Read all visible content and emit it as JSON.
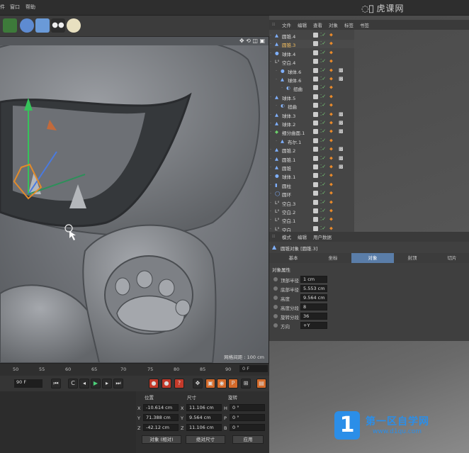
{
  "menubar": {
    "items": [
      "件",
      "窗口",
      "帮助"
    ]
  },
  "watermark_top": "虎课网",
  "viewport": {
    "grid_label": "网格间距 : 100 cm"
  },
  "timeline": {
    "ticks": [
      "50",
      "55",
      "60",
      "65",
      "70",
      "75",
      "80",
      "85",
      "90"
    ],
    "current": "0 F",
    "end_frame": "90 F"
  },
  "coords": {
    "headers": {
      "position": "位置",
      "size": "尺寸",
      "rotation": "旋转"
    },
    "rows": [
      {
        "axis": "X",
        "pos": "-10.614 cm",
        "saxis": "X",
        "size": "11.106 cm",
        "raxis": "H",
        "rot": "0 °"
      },
      {
        "axis": "Y",
        "pos": "71.388 cm",
        "saxis": "Y",
        "size": "9.564 cm",
        "raxis": "P",
        "rot": "0 °"
      },
      {
        "axis": "Z",
        "pos": "-42.12 cm",
        "saxis": "Z",
        "size": "11.106 cm",
        "raxis": "B",
        "rot": "0 °"
      }
    ],
    "mode1": "对象 (相对)",
    "mode2": "绝对尺寸",
    "apply": "应用"
  },
  "object_manager": {
    "menu": [
      "文件",
      "编辑",
      "查看",
      "对象",
      "标签",
      "书签"
    ],
    "objects": [
      {
        "name": "圆锥.4",
        "indent": 0,
        "icon": "cone"
      },
      {
        "name": "圆锥.3",
        "indent": 0,
        "icon": "cone",
        "selected": true
      },
      {
        "name": "球体.4",
        "indent": 0,
        "icon": "sphere"
      },
      {
        "name": "空白.4",
        "indent": 0,
        "icon": "null"
      },
      {
        "name": "球体.6",
        "indent": 1,
        "icon": "sphere"
      },
      {
        "name": "球体.6",
        "indent": 1,
        "icon": "cone"
      },
      {
        "name": "扭曲",
        "indent": 2,
        "icon": "deformer"
      },
      {
        "name": "球体.5",
        "indent": 0,
        "icon": "cone"
      },
      {
        "name": "扭曲",
        "indent": 1,
        "icon": "deformer"
      },
      {
        "name": "球体.3",
        "indent": 0,
        "icon": "cone"
      },
      {
        "name": "球体.2",
        "indent": 0,
        "icon": "cone"
      },
      {
        "name": "细分曲面.1",
        "indent": 0,
        "icon": "subdiv"
      },
      {
        "name": "布尔.1",
        "indent": 1,
        "icon": "cone"
      },
      {
        "name": "圆锥.2",
        "indent": 0,
        "icon": "cone"
      },
      {
        "name": "圆锥.1",
        "indent": 0,
        "icon": "cone"
      },
      {
        "name": "圆锥",
        "indent": 0,
        "icon": "cone"
      },
      {
        "name": "球体.1",
        "indent": 0,
        "icon": "sphere"
      },
      {
        "name": "圆柱",
        "indent": 0,
        "icon": "cylinder"
      },
      {
        "name": "圆环",
        "indent": 0,
        "icon": "torus"
      },
      {
        "name": "空白.3",
        "indent": 0,
        "icon": "null"
      },
      {
        "name": "空白.2",
        "indent": 0,
        "icon": "null"
      },
      {
        "name": "空白.1",
        "indent": 0,
        "icon": "null"
      },
      {
        "name": "空白",
        "indent": 0,
        "icon": "null"
      }
    ]
  },
  "attributes": {
    "menu": [
      "模式",
      "编辑",
      "用户数据"
    ],
    "title": "圆锥对象 [圆锥.3]",
    "tabs": [
      "基本",
      "坐标",
      "对象",
      "封顶",
      "切片"
    ],
    "active_tab": "对象",
    "section": "对象属性",
    "fields": [
      {
        "label": "顶部半径",
        "value": "1 cm"
      },
      {
        "label": "底部半径",
        "value": "5.553 cm"
      },
      {
        "label": "高度",
        "value": "9.564 cm"
      },
      {
        "label": "高度分段",
        "value": "8"
      },
      {
        "label": "旋转分段",
        "value": "36"
      },
      {
        "label": "方向",
        "value": "+Y"
      }
    ]
  },
  "watermark_bottom": {
    "brand": "第一区自学网",
    "url": "www.d1qu.com",
    "logo_char": "1"
  }
}
